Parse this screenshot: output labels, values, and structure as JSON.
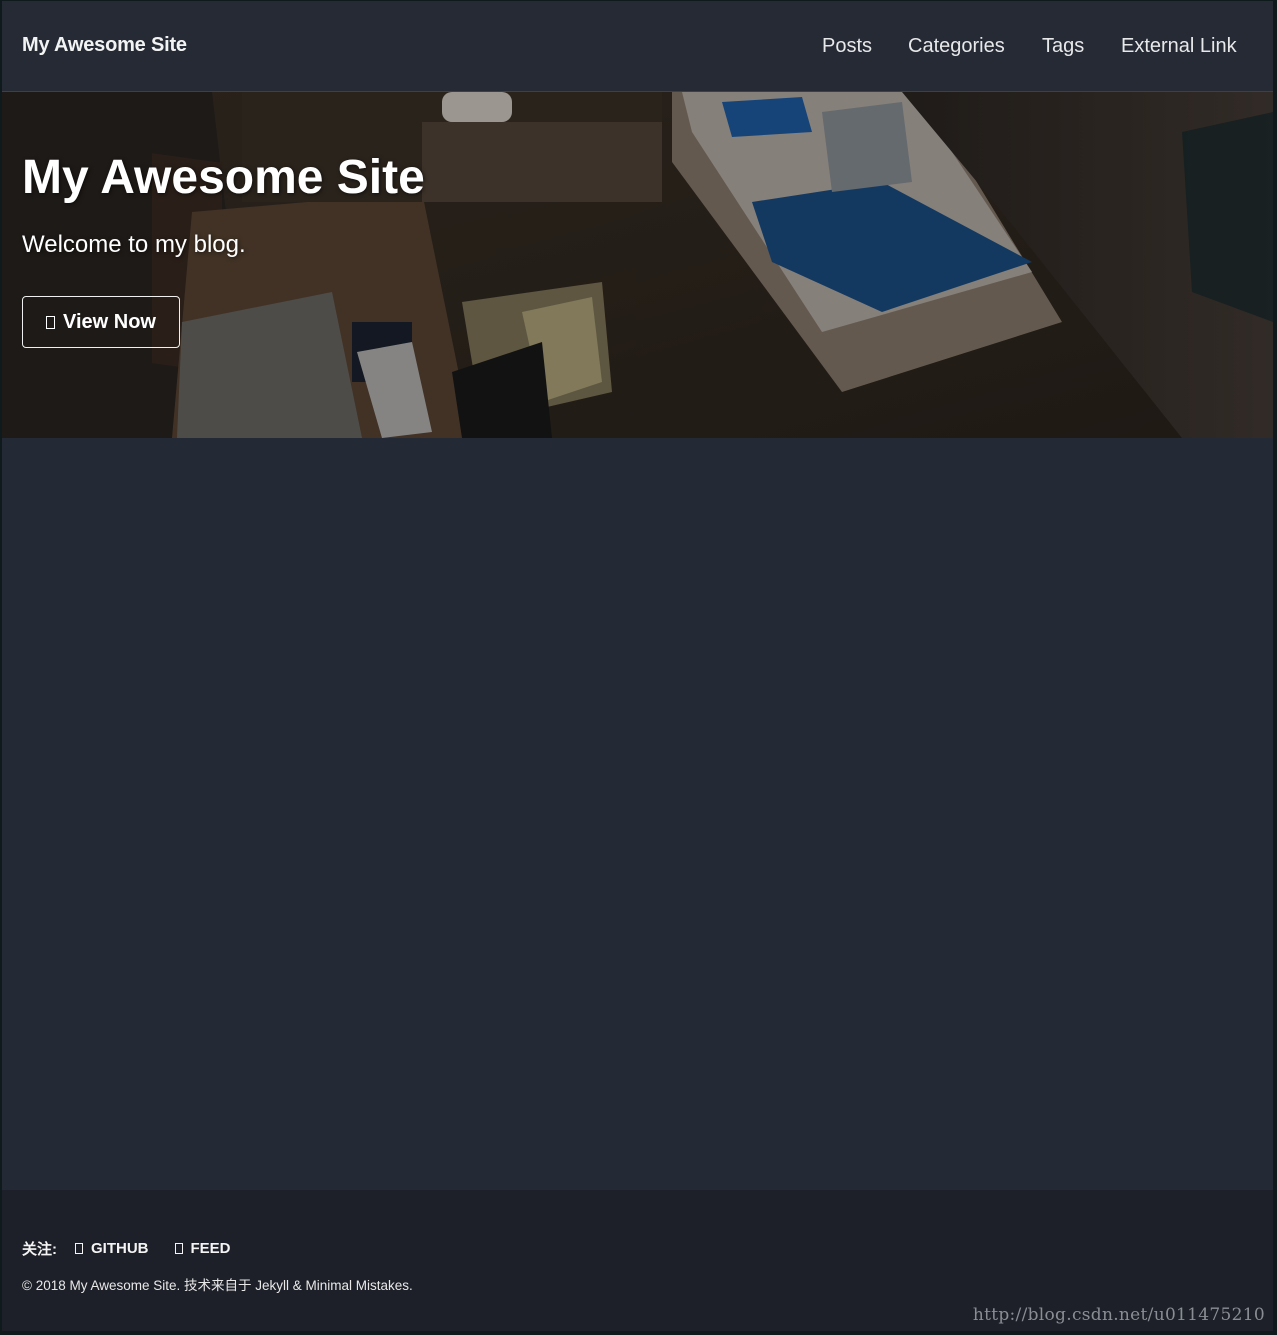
{
  "masthead": {
    "site_title": "My Awesome Site",
    "nav": [
      "Posts",
      "Categories",
      "Tags",
      "External Link"
    ]
  },
  "hero": {
    "title": "My Awesome Site",
    "tagline": "Welcome to my blog.",
    "button_label": "View Now",
    "button_icon": "arrow-icon"
  },
  "footer": {
    "follow_label": "关注:",
    "links": [
      {
        "icon": "github-icon",
        "label": "GITHUB"
      },
      {
        "icon": "rss-icon",
        "label": "FEED"
      }
    ],
    "copyright": "© 2018 My Awesome Site. 技术来自于 Jekyll & Minimal Mistakes."
  },
  "watermark": "http://blog.csdn.net/u011475210",
  "colors": {
    "background": "#242a35",
    "footer": "#1d2028",
    "text": "#f2f3f3"
  }
}
